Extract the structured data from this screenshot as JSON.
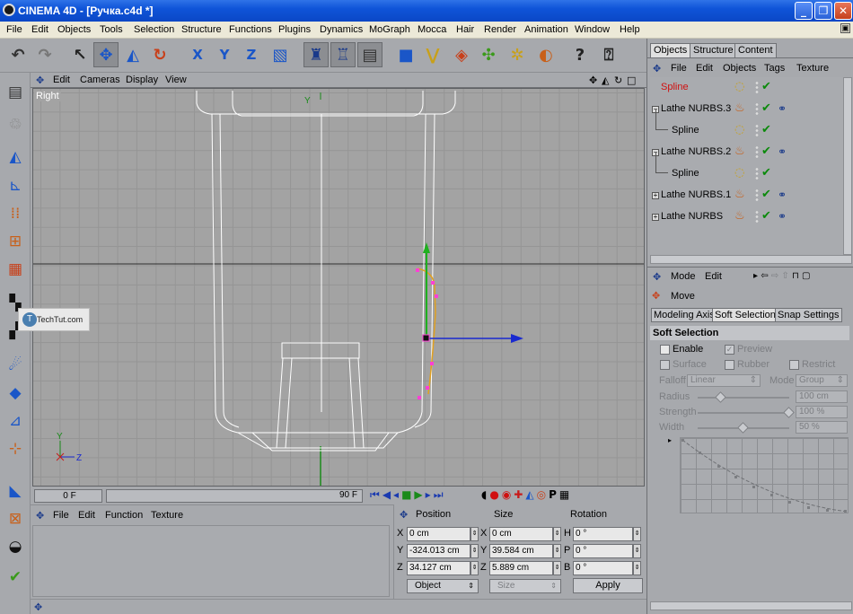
{
  "window": {
    "title": "CINEMA 4D - [Ручка.c4d *]",
    "min_label": "_",
    "max_label": "❐",
    "close_label": "✕"
  },
  "menu": [
    "File",
    "Edit",
    "Objects",
    "Tools",
    "Selection",
    "Structure",
    "Functions",
    "Plugins",
    "Dynamics",
    "MoGraph",
    "Mocca",
    "Hair",
    "Render",
    "Animation",
    "Window",
    "Help"
  ],
  "viewport": {
    "menu": [
      "Edit",
      "Cameras",
      "Display",
      "View"
    ],
    "label": "Right",
    "axis_y": "Y",
    "axis_z": "Z",
    "watermark": "TechTut.com"
  },
  "timeline": {
    "current_frame": "0 F",
    "end_frame": "90 F"
  },
  "material_panel": {
    "menu": [
      "File",
      "Edit",
      "Function",
      "Texture"
    ]
  },
  "coords": {
    "headers": [
      "Position",
      "Size",
      "Rotation"
    ],
    "pos": [
      {
        "axis": "X",
        "value": "0 cm"
      },
      {
        "axis": "Y",
        "value": "-324.013 cm"
      },
      {
        "axis": "Z",
        "value": "34.127 cm"
      }
    ],
    "size": [
      {
        "axis": "X",
        "value": "0 cm"
      },
      {
        "axis": "Y",
        "value": "39.584 cm"
      },
      {
        "axis": "Z",
        "value": "5.889 cm"
      }
    ],
    "rot": [
      {
        "axis": "H",
        "value": "0 °"
      },
      {
        "axis": "P",
        "value": "0 °"
      },
      {
        "axis": "B",
        "value": "0 °"
      }
    ],
    "mode": "Object",
    "size_mode": "Size",
    "apply_label": "Apply"
  },
  "objects_panel": {
    "tabs": [
      "Objects",
      "Structure",
      "Content"
    ],
    "menu": [
      "File",
      "Edit",
      "Objects",
      "Tags",
      "Texture"
    ],
    "items": [
      {
        "name": "Spline",
        "level": 1,
        "highlight": true,
        "icon": "spline-icon",
        "expand": ""
      },
      {
        "name": "Lathe NURBS.3",
        "level": 0,
        "highlight": false,
        "icon": "lathe-icon",
        "expand": "−"
      },
      {
        "name": "Spline",
        "level": 1,
        "highlight": false,
        "icon": "spline-icon",
        "expand": ""
      },
      {
        "name": "Lathe NURBS.2",
        "level": 0,
        "highlight": false,
        "icon": "lathe-icon",
        "expand": "−"
      },
      {
        "name": "Spline",
        "level": 1,
        "highlight": false,
        "icon": "spline-icon",
        "expand": ""
      },
      {
        "name": "Lathe NURBS.1",
        "level": 0,
        "highlight": false,
        "icon": "lathe-icon",
        "expand": "+"
      },
      {
        "name": "Lathe NURBS",
        "level": 0,
        "highlight": false,
        "icon": "lathe-icon",
        "expand": "+"
      }
    ]
  },
  "attributes": {
    "menu": [
      "Mode",
      "Edit"
    ],
    "tool": "Move",
    "tabs": [
      "Modeling Axis",
      "Soft Selection",
      "Snap Settings"
    ],
    "section": "Soft Selection",
    "enable": "Enable",
    "preview": "Preview",
    "surface": "Surface",
    "rubber": "Rubber",
    "restrict": "Restrict",
    "falloff_label": "Falloff",
    "falloff_value": "Linear",
    "mode_label": "Mode",
    "mode_value": "Group",
    "radius_label": "Radius",
    "radius_value": "100 cm",
    "radius_level": 0.25,
    "strength_label": "Strength",
    "strength_value": "100 %",
    "strength_level": 1.0,
    "width_label": "Width",
    "width_value": "50 %",
    "width_level": 0.5
  },
  "colors": {
    "accent": "#0a47c6",
    "spline_highlight": "#d01010",
    "check": "#0b8a0b"
  }
}
